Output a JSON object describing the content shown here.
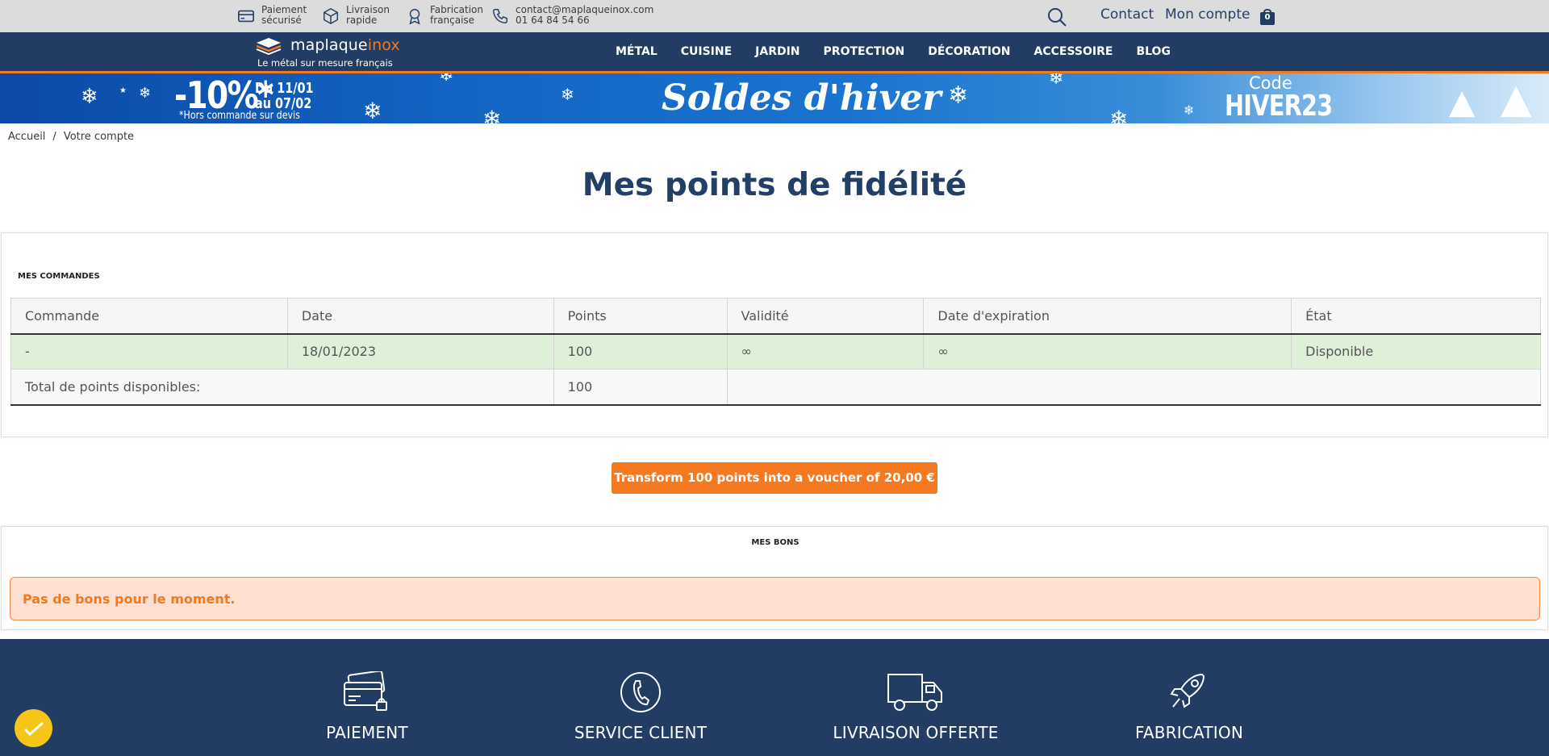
{
  "topbar": {
    "payment": {
      "line1": "Paiement",
      "line2": "sécurisé"
    },
    "delivery": {
      "line1": "Livraison",
      "line2": "rapide"
    },
    "made": {
      "line1": "Fabrication",
      "line2": "française"
    },
    "contact_info": {
      "email": "contact@maplaqueinox.com",
      "phone": "01 64 84 54 66"
    },
    "contact_link": "Contact",
    "account_link": "Mon compte",
    "cart_count": "0"
  },
  "logo": {
    "name_part1": "maplaque",
    "name_part2": "inox",
    "tagline": "Le métal sur mesure français"
  },
  "nav": {
    "items": [
      "MÉTAL",
      "CUISINE",
      "JARDIN",
      "PROTECTION",
      "DÉCORATION",
      "ACCESSOIRE",
      "BLOG"
    ]
  },
  "banner": {
    "discount": "-10%*",
    "dates_line1": "Du 11/01",
    "dates_line2": "au 07/02",
    "note": "*Hors commande sur devis",
    "headline": "Soldes d'hiver",
    "code_label": "Code",
    "code_value": "HIVER23"
  },
  "breadcrumb": {
    "home": "Accueil",
    "separator": "/",
    "current": "Votre compte"
  },
  "page_title": "Mes points de fidélité",
  "orders": {
    "title": "MES COMMANDES",
    "columns": [
      "Commande",
      "Date",
      "Points",
      "Validité",
      "Date d'expiration",
      "État"
    ],
    "rows": [
      {
        "order": "-",
        "date": "18/01/2023",
        "points": "100",
        "validity": "∞",
        "expiration": "∞",
        "state": "Disponible"
      }
    ],
    "total_label": "Total de points disponibles:",
    "total_value": "100"
  },
  "voucher_button": "Transform 100 points into a voucher of 20,00 €",
  "vouchers": {
    "title": "MES BONS",
    "empty_message": "Pas de bons pour le moment."
  },
  "footer": {
    "features": [
      "PAIEMENT",
      "SERVICE CLIENT",
      "LIVRAISON OFFERTE",
      "FABRICATION"
    ]
  },
  "colors": {
    "navy": "#223c63",
    "orange": "#f47920",
    "success_bg": "#dff0d8",
    "warning_bg": "#fde0cf"
  }
}
